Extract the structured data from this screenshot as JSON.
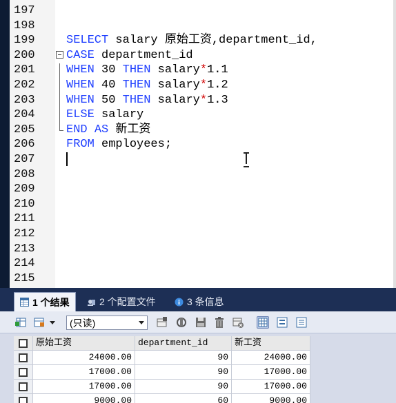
{
  "editor": {
    "lines": [
      {
        "n": "197",
        "tokens": []
      },
      {
        "n": "198",
        "tokens": []
      },
      {
        "n": "199",
        "tokens": [
          {
            "t": "SELECT",
            "c": "kw"
          },
          {
            "t": " salary 原始工资,department_id,",
            "c": ""
          }
        ]
      },
      {
        "n": "200",
        "fold": true,
        "tokens": [
          {
            "t": "CASE",
            "c": "kw"
          },
          {
            "t": " department_id",
            "c": ""
          }
        ]
      },
      {
        "n": "201",
        "tokens": [
          {
            "t": "WHEN",
            "c": "kw"
          },
          {
            "t": " 30 ",
            "c": ""
          },
          {
            "t": "THEN",
            "c": "kw"
          },
          {
            "t": " salary",
            "c": ""
          },
          {
            "t": "*",
            "c": "op"
          },
          {
            "t": "1.1",
            "c": ""
          }
        ]
      },
      {
        "n": "202",
        "tokens": [
          {
            "t": "WHEN",
            "c": "kw"
          },
          {
            "t": " 40 ",
            "c": ""
          },
          {
            "t": "THEN",
            "c": "kw"
          },
          {
            "t": " salary",
            "c": ""
          },
          {
            "t": "*",
            "c": "op"
          },
          {
            "t": "1.2",
            "c": ""
          }
        ]
      },
      {
        "n": "203",
        "tokens": [
          {
            "t": "WHEN",
            "c": "kw"
          },
          {
            "t": " 50 ",
            "c": ""
          },
          {
            "t": "THEN",
            "c": "kw"
          },
          {
            "t": " salary",
            "c": ""
          },
          {
            "t": "*",
            "c": "op"
          },
          {
            "t": "1.3",
            "c": ""
          }
        ]
      },
      {
        "n": "204",
        "tokens": [
          {
            "t": "ELSE",
            "c": "kw"
          },
          {
            "t": " salary",
            "c": ""
          }
        ]
      },
      {
        "n": "205",
        "tokens": [
          {
            "t": "END",
            "c": "kw"
          },
          {
            "t": " ",
            "c": ""
          },
          {
            "t": "AS",
            "c": "kw"
          },
          {
            "t": " 新工资",
            "c": ""
          }
        ]
      },
      {
        "n": "206",
        "tokens": [
          {
            "t": "FROM",
            "c": "kw"
          },
          {
            "t": " employees;",
            "c": ""
          }
        ]
      },
      {
        "n": "207",
        "tokens": []
      },
      {
        "n": "208",
        "tokens": []
      },
      {
        "n": "209",
        "tokens": []
      },
      {
        "n": "210",
        "tokens": []
      },
      {
        "n": "211",
        "tokens": []
      },
      {
        "n": "212",
        "tokens": []
      },
      {
        "n": "213",
        "tokens": []
      },
      {
        "n": "214",
        "tokens": []
      },
      {
        "n": "215",
        "tokens": []
      }
    ]
  },
  "result_tabs": [
    {
      "label": "1 个结果",
      "icon": "result-grid-icon",
      "active": true
    },
    {
      "label": "2 个配置文件",
      "icon": "profile-icon",
      "active": false
    },
    {
      "label": "3 条信息",
      "icon": "info-icon",
      "active": false
    }
  ],
  "toolbar": {
    "mode_select": "(只读)"
  },
  "table": {
    "columns": [
      "原始工资",
      "department_id",
      "新工资"
    ],
    "rows": [
      [
        "24000.00",
        "90",
        "24000.00"
      ],
      [
        "17000.00",
        "90",
        "17000.00"
      ],
      [
        "17000.00",
        "90",
        "17000.00"
      ],
      [
        "9000.00",
        "60",
        "9000.00"
      ]
    ]
  },
  "colors": {
    "keyword": "#1f3fff",
    "operator": "#d10000",
    "tabbar": "#1d2f55"
  }
}
